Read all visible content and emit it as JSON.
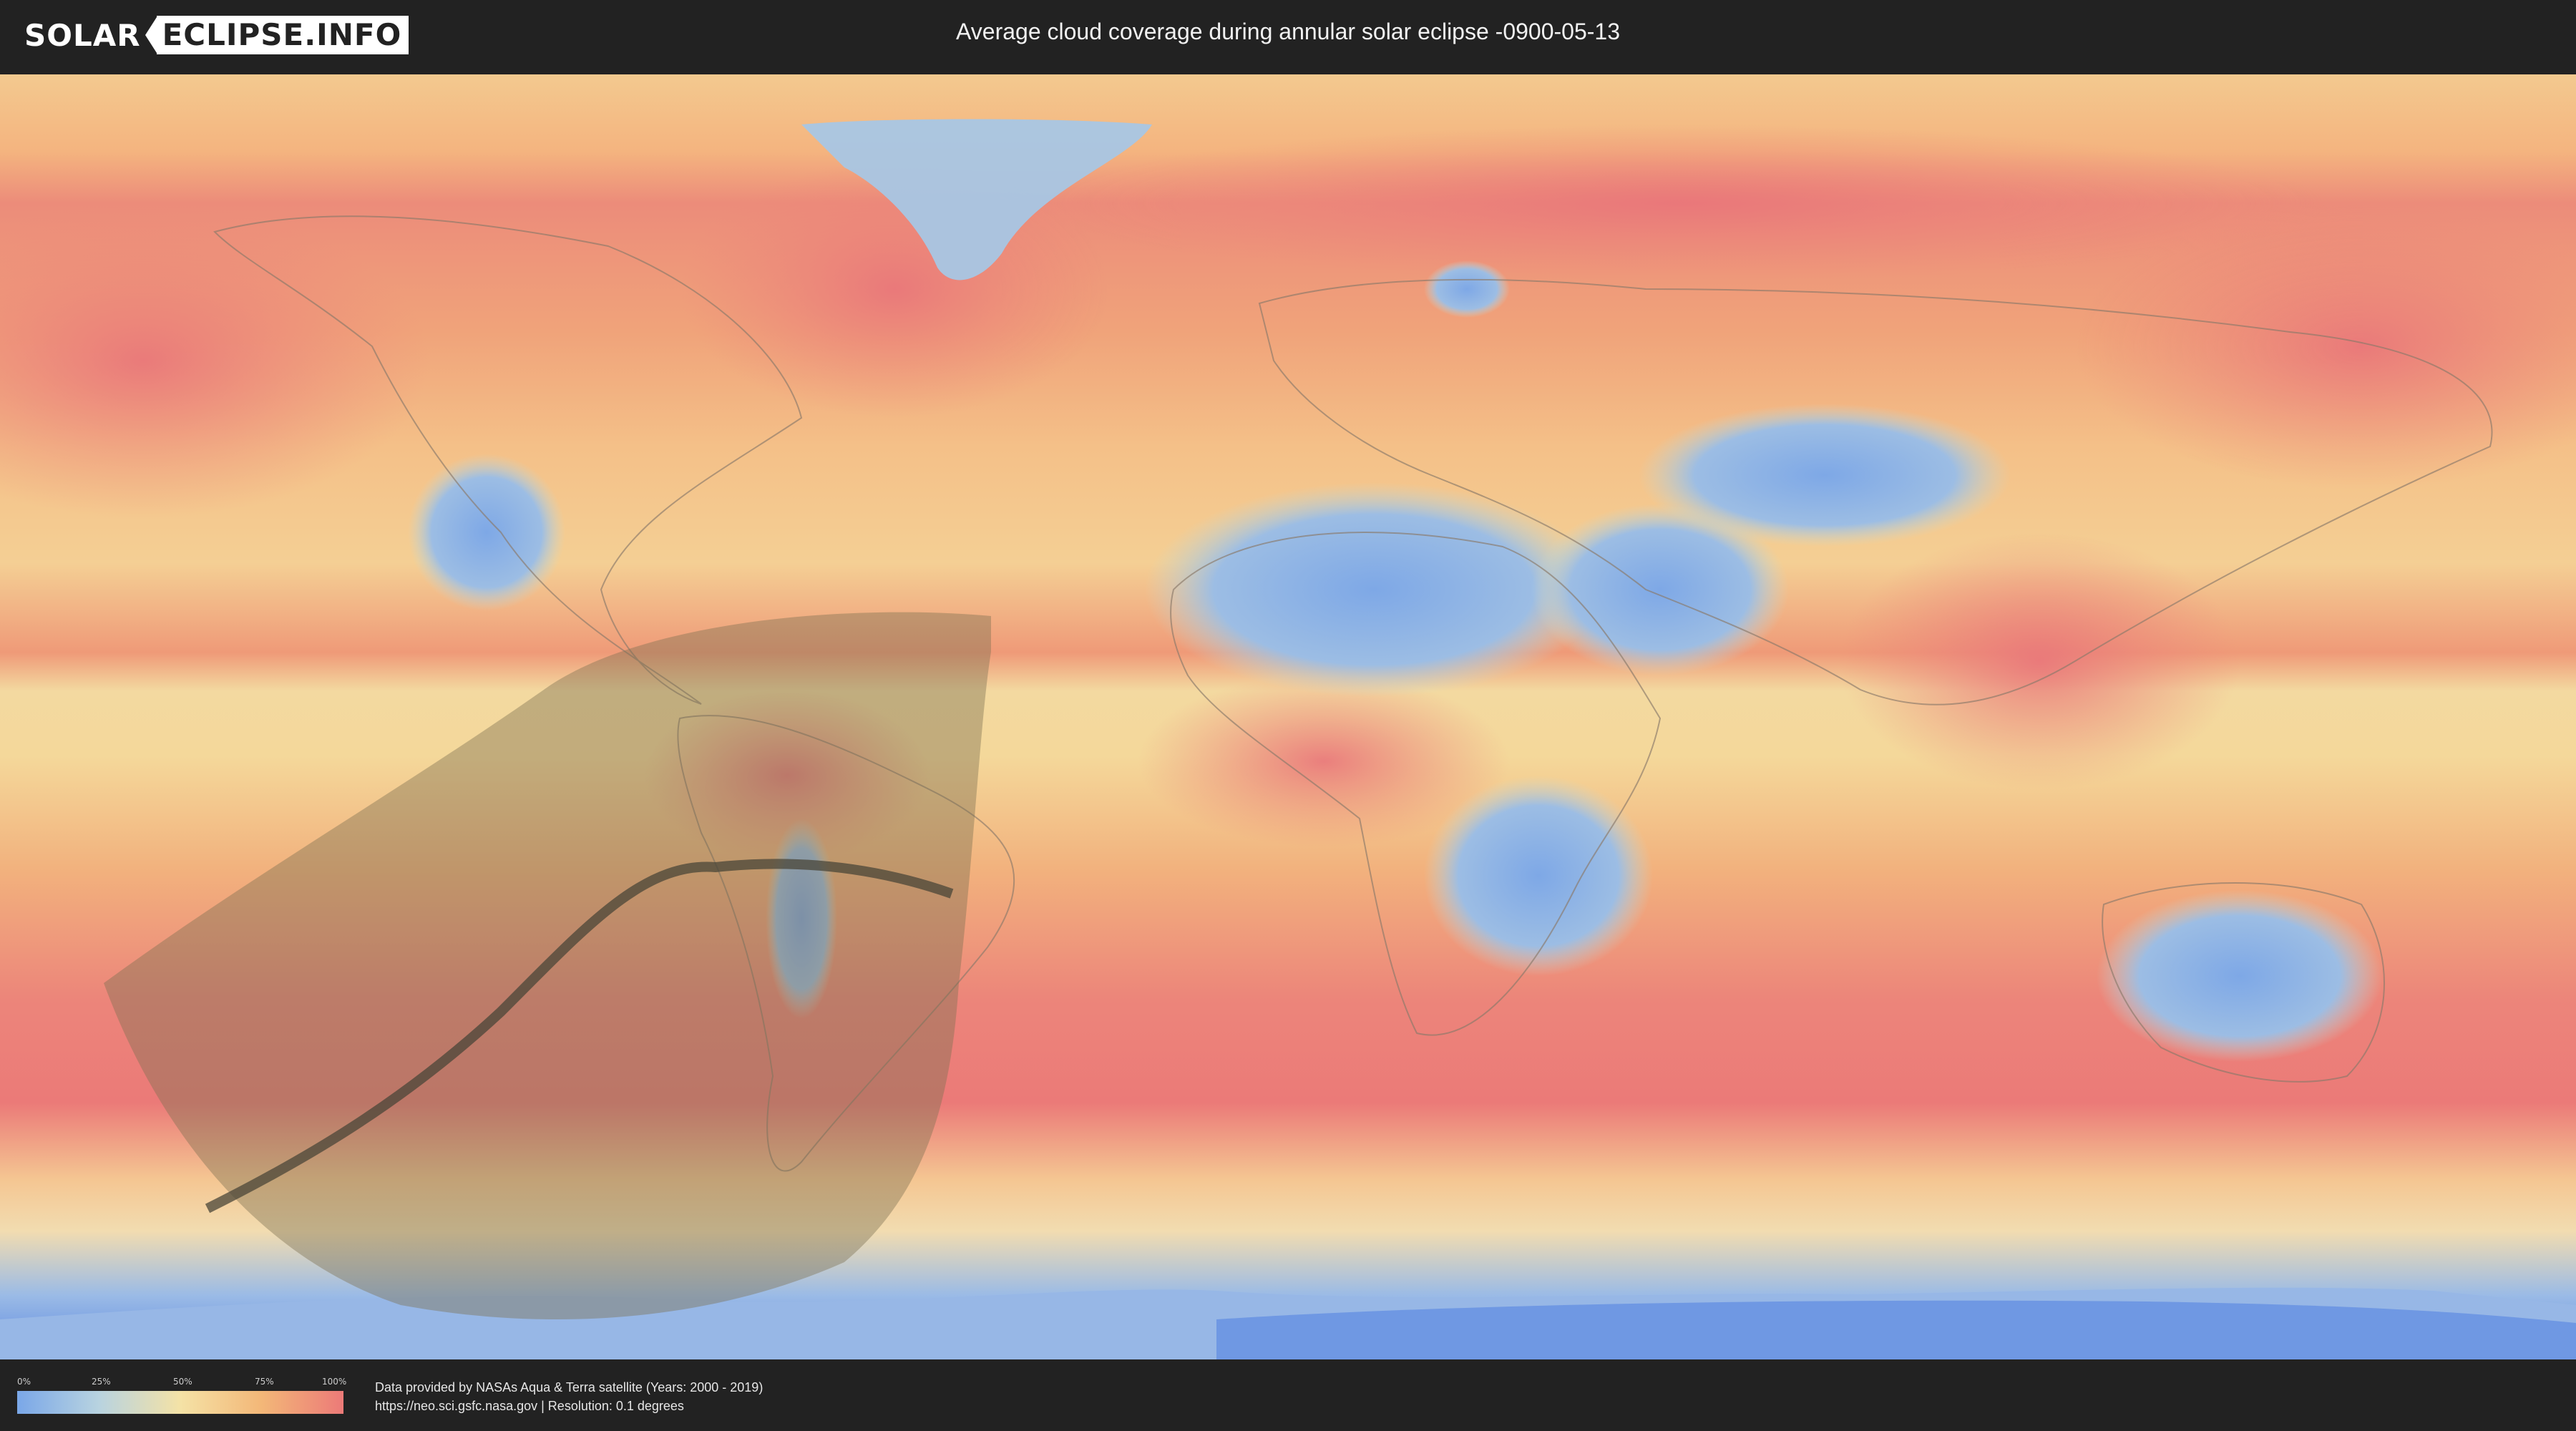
{
  "header": {
    "logo_part1": "SOLAR",
    "logo_part2": "ECLIPSE.INFO",
    "title": "Average cloud coverage during annular solar eclipse -0900-05-13"
  },
  "legend": {
    "ticks": [
      "0%",
      "25%",
      "50%",
      "75%",
      "100%"
    ],
    "tick_values": [
      0,
      25,
      50,
      75,
      100
    ],
    "colors": [
      "#7aa7e8",
      "#b8d3e0",
      "#f4e2a6",
      "#f3b778",
      "#ec7a78"
    ]
  },
  "footer": {
    "credit_line1": "Data provided by NASAs Aqua & Terra satellite (Years: 2000 - 2019)",
    "credit_line2": "https://neo.sci.gsfc.nasa.gov | Resolution: 0.1 degrees"
  },
  "map": {
    "colors": {
      "cloudy": "#ec7a78",
      "partly": "#f4d89a",
      "clear": "#8eb3e6",
      "eclipse_zone": "#7d7050",
      "central_path": "#4a4538"
    },
    "icon": "world-map"
  }
}
